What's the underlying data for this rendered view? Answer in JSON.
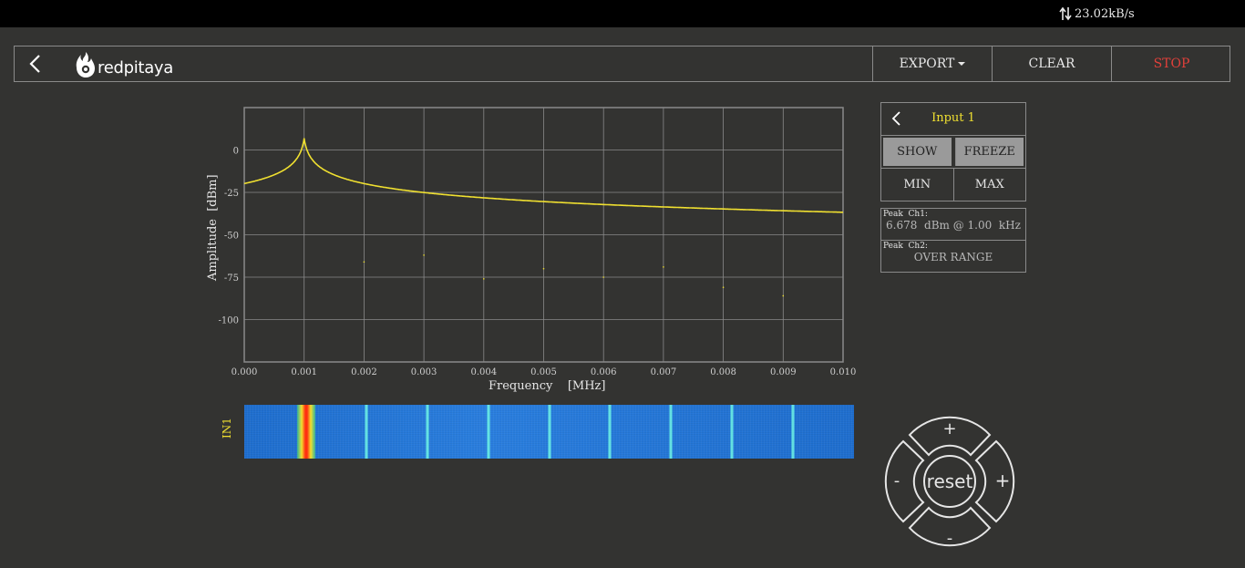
{
  "status_bar": {
    "net_speed": "23.02kB/s"
  },
  "toolbar": {
    "logo_text": "redpitaya",
    "export_label": "EXPORT",
    "clear_label": "CLEAR",
    "stop_label": "STOP"
  },
  "spectrum_panel": {
    "input_label": "Input 1",
    "show_label": "SHOW",
    "freeze_label": "FREEZE",
    "min_label": "MIN",
    "max_label": "MAX",
    "peak_ch1_label": "Peak  Ch1:",
    "peak_ch1_value": "6.678  dBm @ 1.00  kHz",
    "peak_ch2_label": "Peak  Ch2:",
    "peak_ch2_value": "OVER RANGE"
  },
  "waterfall": {
    "label": "IN1"
  },
  "dpad": {
    "reset_label": "reset",
    "plus": "+",
    "minus": "-"
  },
  "colors": {
    "background": "#333331",
    "trace": "#f0e030",
    "stop": "#e0403a",
    "grid": "#8a8a8a",
    "waterfall_base": "#2a7fe0"
  },
  "chart_data": {
    "type": "line",
    "xlabel": "Frequency    [MHz]",
    "ylabel": "Amplitude  [dBm]",
    "xlim": [
      0,
      0.01
    ],
    "ylim": [
      -125,
      25
    ],
    "x_ticks": [
      "0.000",
      "0.001",
      "0.002",
      "0.003",
      "0.004",
      "0.005",
      "0.006",
      "0.007",
      "0.008",
      "0.009",
      "0.010"
    ],
    "y_ticks": [
      "0",
      "-25",
      "-50",
      "-75",
      "-100"
    ],
    "y_tick_values": [
      0,
      -25,
      -50,
      -75,
      -100
    ],
    "grid": true,
    "series": [
      {
        "color": "#f0e030",
        "noise_floor": -100,
        "peaks": [
          {
            "x": 0.001,
            "y": 6.678
          },
          {
            "x": 0.002,
            "y": -66
          },
          {
            "x": 0.003,
            "y": -62
          },
          {
            "x": 0.004,
            "y": -76
          },
          {
            "x": 0.005,
            "y": -70
          },
          {
            "x": 0.006,
            "y": -75
          },
          {
            "x": 0.007,
            "y": -69
          },
          {
            "x": 0.008,
            "y": -81
          },
          {
            "x": 0.009,
            "y": -86
          }
        ]
      }
    ]
  }
}
